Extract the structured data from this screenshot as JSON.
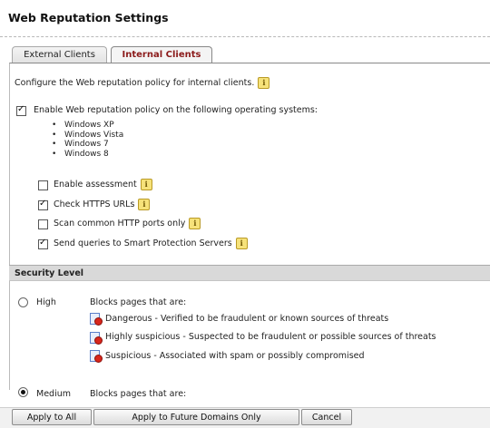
{
  "page": {
    "title": "Web Reputation Settings"
  },
  "tabs": [
    {
      "label": "External Clients",
      "active": false
    },
    {
      "label": "Internal Clients",
      "active": true
    }
  ],
  "intro": {
    "text": "Configure the Web reputation policy for internal clients."
  },
  "policy": {
    "enable_label": "Enable Web reputation policy on the following operating systems:",
    "enabled": true,
    "os_list": [
      "Windows XP",
      "Windows Vista",
      "Windows 7",
      "Windows 8"
    ]
  },
  "options": [
    {
      "label": "Enable assessment",
      "checked": false
    },
    {
      "label": "Check HTTPS URLs",
      "checked": true
    },
    {
      "label": "Scan common HTTP ports only",
      "checked": false
    },
    {
      "label": "Send queries to Smart Protection Servers",
      "checked": true
    }
  ],
  "security": {
    "heading": "Security Level",
    "levels": [
      {
        "label": "High",
        "selected": false,
        "description": "Blocks pages that are:",
        "items": [
          "Dangerous - Verified to be fraudulent or known sources of threats",
          "Highly suspicious - Suspected to be fraudulent or possible sources of threats",
          "Suspicious - Associated with spam or possibly compromised"
        ]
      },
      {
        "label": "Medium",
        "selected": true,
        "description": "Blocks pages that are:"
      }
    ]
  },
  "buttons": {
    "apply_all": "Apply to All",
    "apply_future": "Apply to Future Domains Only",
    "cancel": "Cancel"
  },
  "icons": {
    "info": "info-icon",
    "risk": "blocked-page-icon"
  }
}
